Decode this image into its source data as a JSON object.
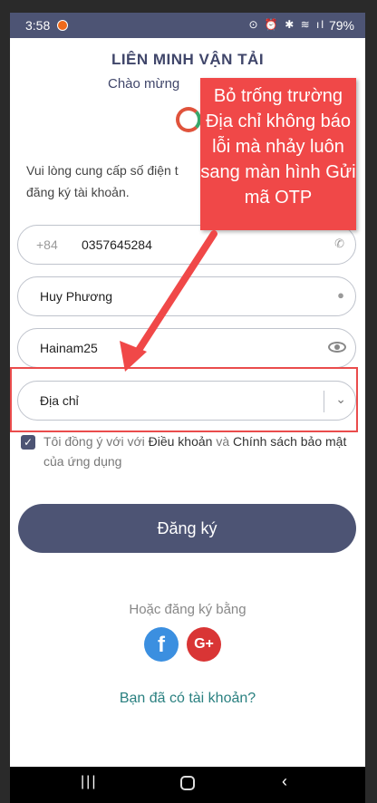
{
  "status": {
    "time": "3:58",
    "battery": "79%",
    "icons": "⊙ ⏰ ✱ ≋ ıl"
  },
  "header": {
    "title": "LIÊN MINH VẬN TẢI",
    "subtitle": "Chào mừng"
  },
  "intro": "Vui lòng cung cấp số điện t\nđăng ký tài khoản.",
  "form": {
    "phone_prefix": "+84",
    "phone": "0357645284",
    "name": "Huy Phương",
    "password": "Hainam25",
    "address_placeholder": "Địa chỉ"
  },
  "agree": {
    "prefix": "Tôi đồng ý với với ",
    "terms": "Điều khoản",
    "and": " và ",
    "policy": "Chính sách bảo mật",
    "suffix": "của ứng dụng"
  },
  "submit_label": "Đăng ký",
  "alt_signup": "Hoặc đăng ký bằng",
  "social": {
    "facebook": "f",
    "google": "G+"
  },
  "login_link": "Bạn đã có tài khoản?",
  "annotation": "Bỏ trống trường Địa chỉ không báo lỗi mà nhảy luôn sang màn hình Gửi mã OTP",
  "colors": {
    "primary": "#4d5474",
    "annotation": "#f04848",
    "link": "#2a8080"
  }
}
